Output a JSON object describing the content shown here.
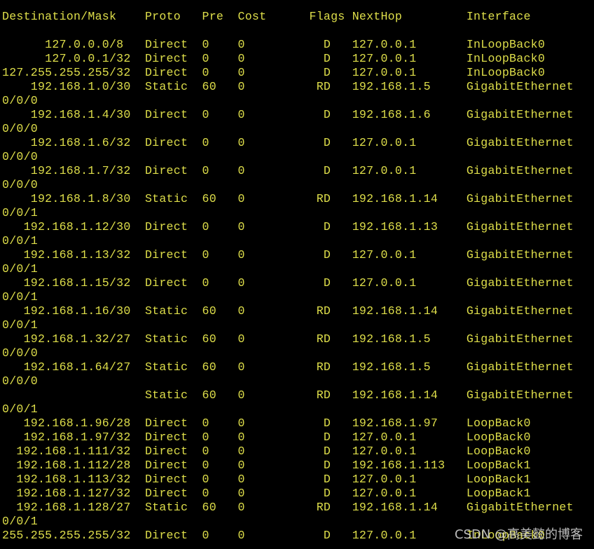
{
  "colors": {
    "background": "#000000",
    "text": "#dede4a",
    "watermark": "#cfcfcf"
  },
  "terminal": {
    "lines": [
      "Destination/Mask    Proto   Pre  Cost      Flags NextHop         Interface",
      "",
      "      127.0.0.0/8   Direct  0    0           D   127.0.0.1       InLoopBack0",
      "      127.0.0.1/32  Direct  0    0           D   127.0.0.1       InLoopBack0",
      "127.255.255.255/32  Direct  0    0           D   127.0.0.1       InLoopBack0",
      "    192.168.1.0/30  Static  60   0          RD   192.168.1.5     GigabitEthernet",
      "0/0/0",
      "    192.168.1.4/30  Direct  0    0           D   192.168.1.6     GigabitEthernet",
      "0/0/0",
      "    192.168.1.6/32  Direct  0    0           D   127.0.0.1       GigabitEthernet",
      "0/0/0",
      "    192.168.1.7/32  Direct  0    0           D   127.0.0.1       GigabitEthernet",
      "0/0/0",
      "    192.168.1.8/30  Static  60   0          RD   192.168.1.14    GigabitEthernet",
      "0/0/1",
      "   192.168.1.12/30  Direct  0    0           D   192.168.1.13    GigabitEthernet",
      "0/0/1",
      "   192.168.1.13/32  Direct  0    0           D   127.0.0.1       GigabitEthernet",
      "0/0/1",
      "   192.168.1.15/32  Direct  0    0           D   127.0.0.1       GigabitEthernet",
      "0/0/1",
      "   192.168.1.16/30  Static  60   0          RD   192.168.1.14    GigabitEthernet",
      "0/0/1",
      "   192.168.1.32/27  Static  60   0          RD   192.168.1.5     GigabitEthernet",
      "0/0/0",
      "   192.168.1.64/27  Static  60   0          RD   192.168.1.5     GigabitEthernet",
      "0/0/0",
      "                    Static  60   0          RD   192.168.1.14    GigabitEthernet",
      "0/0/1",
      "   192.168.1.96/28  Direct  0    0           D   192.168.1.97    LoopBack0",
      "   192.168.1.97/32  Direct  0    0           D   127.0.0.1       LoopBack0",
      "  192.168.1.111/32  Direct  0    0           D   127.0.0.1       LoopBack0",
      "  192.168.1.112/28  Direct  0    0           D   192.168.1.113   LoopBack1",
      "  192.168.1.113/32  Direct  0    0           D   127.0.0.1       LoopBack1",
      "  192.168.1.127/32  Direct  0    0           D   127.0.0.1       LoopBack1",
      "  192.168.1.128/27  Static  60   0          RD   192.168.1.14    GigabitEthernet",
      "0/0/1",
      "255.255.255.255/32  Direct  0    0           D   127.0.0.1       InLoopBack0"
    ]
  },
  "watermark": {
    "text": "CSDN @高美懿的博客"
  }
}
